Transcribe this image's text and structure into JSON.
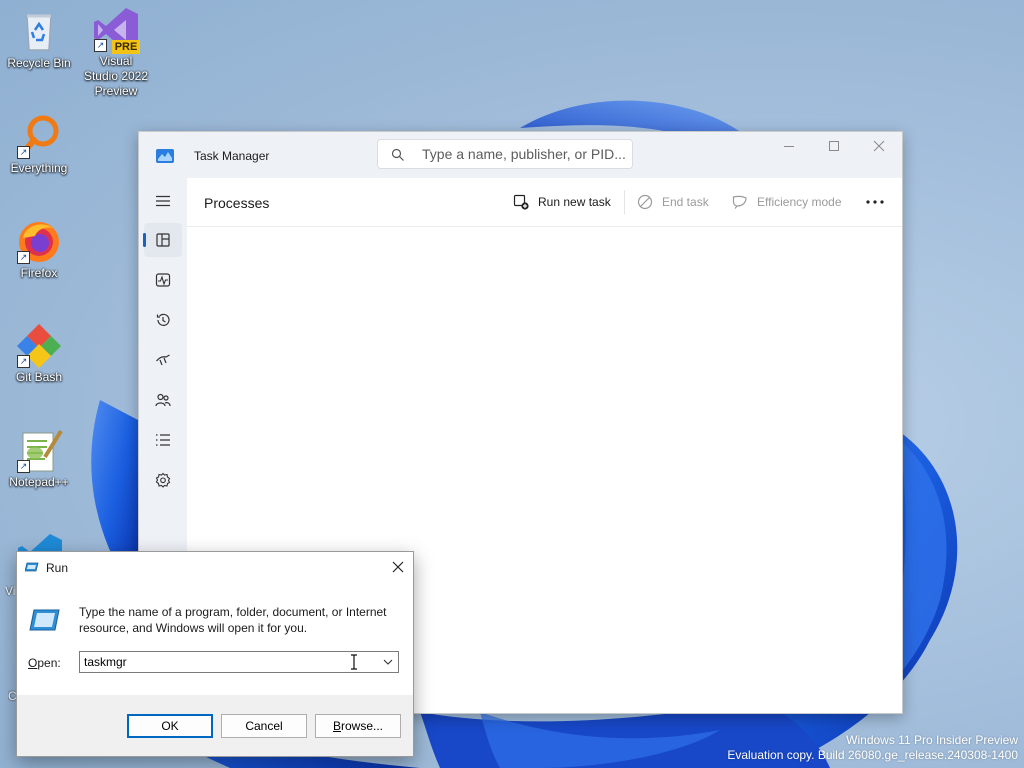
{
  "desktop": {
    "icons": [
      {
        "label": "Recycle Bin"
      },
      {
        "label": "Visual Studio 2022 Preview",
        "badge": "PRE"
      },
      {
        "label": "Everything"
      },
      {
        "label": "Firefox"
      },
      {
        "label": "Git Bash"
      },
      {
        "label": "Notepad++"
      },
      {
        "label": "Vi"
      },
      {
        "label": "C"
      }
    ],
    "watermark": {
      "line1": "Windows 11 Pro Insider Preview",
      "line2": "Evaluation copy. Build 26080.ge_release.240308-1400"
    }
  },
  "task_manager": {
    "title": "Task Manager",
    "search_placeholder": "Type a name, publisher, or PID...",
    "page_title": "Processes",
    "toolbar": {
      "run_new_task": "Run new task",
      "end_task": "End task",
      "efficiency_mode": "Efficiency mode"
    },
    "nav": [
      "processes-icon",
      "performance-icon",
      "app-history-icon",
      "startup-apps-icon",
      "users-icon",
      "details-icon",
      "services-icon"
    ]
  },
  "run_dialog": {
    "title": "Run",
    "description": "Type the name of a program, folder, document, or Internet resource, and Windows will open it for you.",
    "open_label_mnemonic": "O",
    "open_label_rest": "pen:",
    "open_value": "taskmgr",
    "ok_label": "OK",
    "cancel_label": "Cancel",
    "browse_mnemonic": "B",
    "browse_rest": "rowse..."
  },
  "colors": {
    "accent": "#0067c0",
    "nav_indicator": "#1f5fbf",
    "titlebar": "#eef2f7"
  }
}
